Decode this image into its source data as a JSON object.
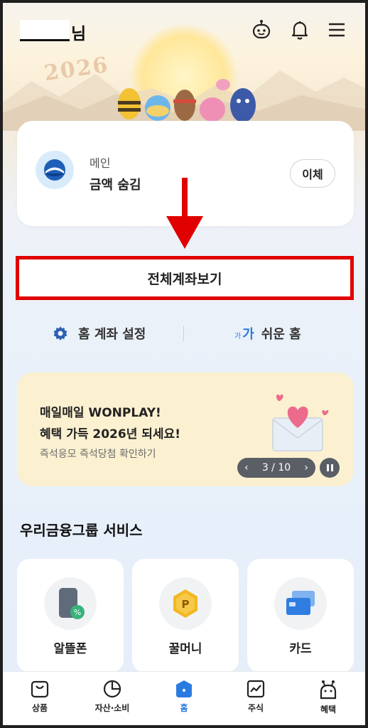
{
  "header": {
    "name_suffix": "님",
    "icons": [
      "robot-face-icon",
      "bell-icon",
      "menu-icon"
    ]
  },
  "banner": {
    "year_text": "2026"
  },
  "account": {
    "title": "메인",
    "balance_text": "금액 숨김",
    "transfer_label": "이체"
  },
  "all_accounts_label": "전체계좌보기",
  "settings": {
    "home_setting_label": "홈 계좌 설정",
    "easy_ga_small": "가",
    "easy_ga_big": "가",
    "easy_home_label": "쉬운 홈"
  },
  "promo": {
    "line1": "매일매일 WONPLAY!",
    "line2": "혜택 가득 2026년 되세요!",
    "sub": "즉석응모 즉석당첨 확인하기",
    "pager_text": "3 / 10"
  },
  "services": {
    "title": "우리금융그룹 서비스",
    "items": [
      {
        "label": "알뜰폰",
        "icon": "phone-icon"
      },
      {
        "label": "꿀머니",
        "icon": "coin-icon"
      },
      {
        "label": "카드",
        "icon": "card-icon"
      }
    ]
  },
  "nav": {
    "items": [
      {
        "label": "상품",
        "icon": "shopping-bag-icon"
      },
      {
        "label": "자산·소비",
        "icon": "pie-chart-icon"
      },
      {
        "label": "홈",
        "icon": "home-icon"
      },
      {
        "label": "주식",
        "icon": "stock-chart-icon"
      },
      {
        "label": "혜택",
        "icon": "benefit-icon"
      }
    ],
    "active_color": "#2a7be0"
  },
  "colors": {
    "highlight_border": "#e00000",
    "accent": "#2a7be0"
  }
}
